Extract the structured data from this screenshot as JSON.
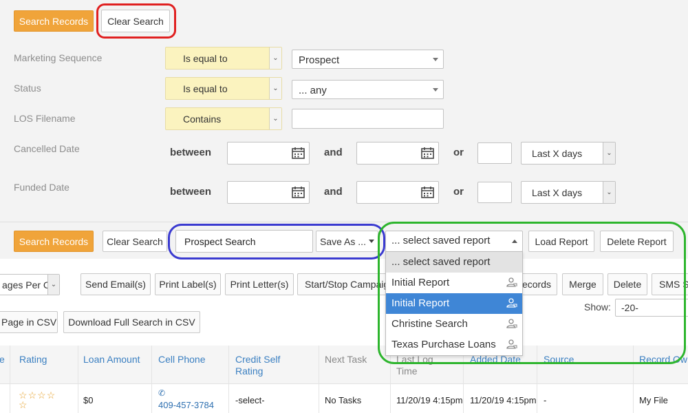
{
  "search_panel": {
    "search_button": "Search Records",
    "clear_button": "Clear Search",
    "fields": [
      {
        "label": "Marketing Sequence",
        "operator": "Is equal to",
        "value": "Prospect"
      },
      {
        "label": "Status",
        "operator": "Is equal to",
        "value": "... any"
      },
      {
        "label": "LOS Filename",
        "operator": "Contains",
        "value": ""
      }
    ],
    "date_fields": [
      {
        "label": "Cancelled Date",
        "between": "between",
        "and": "and",
        "or": "or",
        "range": "Last X days"
      },
      {
        "label": "Funded Date",
        "between": "between",
        "and": "and",
        "or": "or",
        "range": "Last X days"
      }
    ]
  },
  "report_bar": {
    "search_button": "Search Records",
    "clear_button": "Clear Search",
    "search_name_value": "Prospect Search",
    "save_as_button": "Save As ...",
    "saved_report_select": "... select saved report",
    "load_report_button": "Load Report",
    "delete_report_button": "Delete Report"
  },
  "saved_report_dropdown": {
    "items": [
      {
        "label": "... select saved report"
      },
      {
        "label": "Initial Report"
      },
      {
        "label": "Initial Report"
      },
      {
        "label": "Christine Search"
      },
      {
        "label": "Texas Purchase Loans"
      }
    ]
  },
  "actions": {
    "pages_per": "ages Per C",
    "send_email": "Send Email(s)",
    "print_labels": "Print Label(s)",
    "print_letters": "Print Letter(s)",
    "start_stop": "Start/Stop Campaig",
    "records": "ecords",
    "merge": "Merge",
    "delete": "Delete",
    "sms": "SMS S",
    "show_label": "Show:",
    "show_value": "-20-",
    "csv_page": "Page in CSV",
    "csv_full": "Download Full Search in CSV"
  },
  "table": {
    "headers": [
      "e",
      "Rating",
      "Loan Amount",
      "Cell Phone",
      "Credit Self Rating",
      "Next Task",
      "Last Log Time",
      "Added Date",
      "Source",
      "Record Ow"
    ],
    "row": {
      "loan_amount": "$0",
      "cell_phone": "409-457-3784",
      "credit_self_rating": "-select-",
      "next_task": "No Tasks",
      "last_log": "11/20/19 4:15pm",
      "added_date": "11/20/19 4:15pm",
      "source": "-",
      "record_owner": "My File"
    }
  },
  "annotation_colors": {
    "red": "#e02020",
    "blue": "#3a3ad0",
    "green": "#2db52d"
  }
}
